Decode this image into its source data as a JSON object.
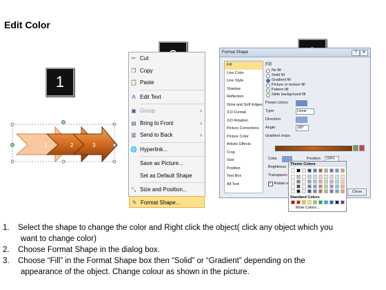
{
  "title": "Edit Color",
  "steps": [
    "1",
    "2",
    "3"
  ],
  "arrows": [
    "1",
    "2",
    "3"
  ],
  "context_menu": [
    {
      "label": "Cut",
      "icon": "scissors-icon",
      "glyph": "✂"
    },
    {
      "label": "Copy",
      "icon": "copy-icon",
      "glyph": "❐"
    },
    {
      "label": "Paste",
      "icon": "paste-icon",
      "glyph": "📋"
    },
    {
      "label": "Edit Text",
      "icon": "edit-text-icon",
      "glyph": "A"
    },
    {
      "label": "Group",
      "icon": "group-icon",
      "glyph": "▣",
      "arrow": "›",
      "disabled": true
    },
    {
      "label": "Bring to Front",
      "icon": "bring-front-icon",
      "glyph": "▤",
      "arrow": "›"
    },
    {
      "label": "Send to Back",
      "icon": "send-back-icon",
      "glyph": "▥",
      "arrow": "›"
    },
    {
      "label": "Hyperlink...",
      "icon": "hyperlink-icon",
      "glyph": "🌐"
    },
    {
      "label": "Save as Picture...",
      "icon": "",
      "glyph": ""
    },
    {
      "label": "Set as Default Shape",
      "icon": "",
      "glyph": ""
    },
    {
      "label": "Size and Position...",
      "icon": "size-position-icon",
      "glyph": "⤡"
    },
    {
      "label": "Format Shape...",
      "icon": "format-shape-icon",
      "glyph": "✎",
      "highlight": true
    }
  ],
  "dialog": {
    "title": "Format Shape",
    "categories": [
      "Fill",
      "Line Color",
      "Line Style",
      "Shadow",
      "Reflection",
      "Glow and Soft Edges",
      "3-D Format",
      "3-D Rotation",
      "Picture Corrections",
      "Picture Color",
      "Artistic Effects",
      "Crop",
      "Size",
      "Position",
      "Text Box",
      "Alt Text"
    ],
    "heading": "Fill",
    "fill_options": [
      "No fill",
      "Solid fill",
      "Gradient fill",
      "Picture or texture fill",
      "Pattern fill",
      "Slide background fill"
    ],
    "selected_fill": 2,
    "preset_colors_label": "Preset colors:",
    "type_label": "Type:",
    "type_value": "Linear",
    "direction_label": "Direction:",
    "angle_label": "Angle:",
    "angle_value": "180°",
    "gradient_stops_label": "Gradient stops",
    "color_label": "Color",
    "position_label": "Position:",
    "position_value": "100%",
    "brightness_label": "Brightness",
    "transparency_label": "Transparen",
    "rotate_label": "Rotate w",
    "close_label": "Close"
  },
  "palette": {
    "theme_label": "Theme Colors",
    "standard_label": "Standard Colors",
    "more_label": "More Colors..."
  },
  "instructions": [
    {
      "num": "1.",
      "text": "Select the shape to change the color and Right click the object( click any object which you",
      "cont": "want to change color)"
    },
    {
      "num": "2.",
      "text": "Choose Format Shape in the dialog box.",
      "cont": ""
    },
    {
      "num": "3.",
      "text": "Choose “Fill” in the Format Shape box then “Solid” or “Gradient” depending on the",
      "cont": "appearance of the object. Change colour as shown in the picture."
    }
  ]
}
